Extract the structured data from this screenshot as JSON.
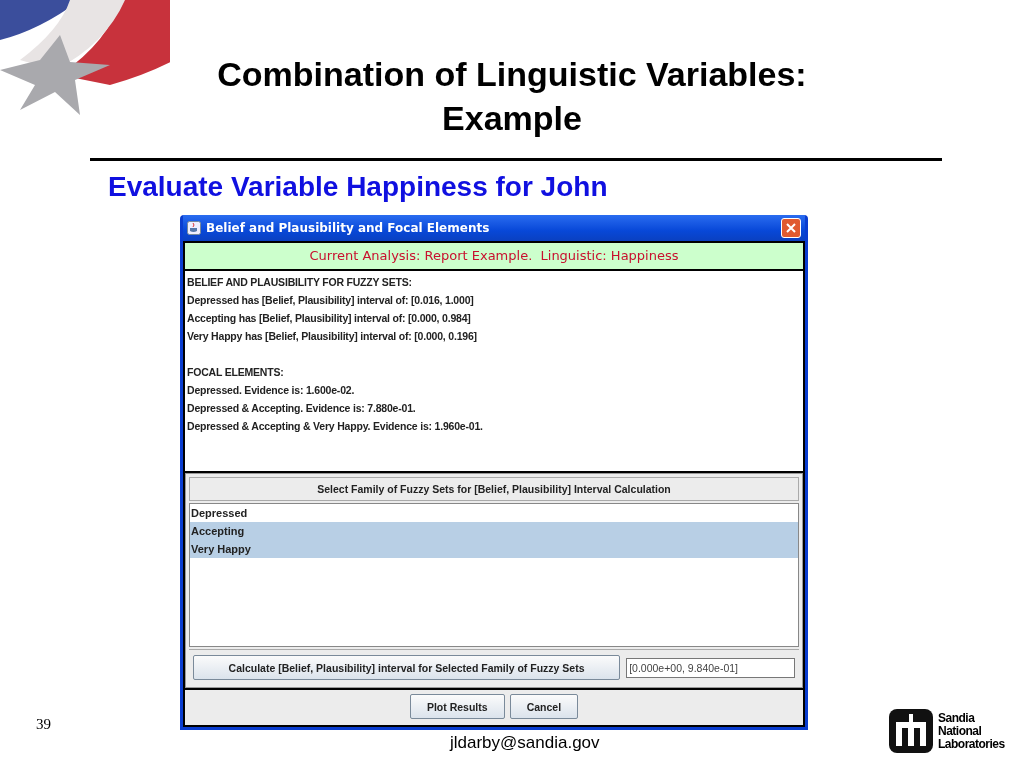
{
  "slide": {
    "title_lines": [
      "Combination of Linguistic Variables:",
      "Example"
    ],
    "subtitle": "Evaluate Variable Happiness for John",
    "page_number": "39",
    "footer": "jldarby@sandia.gov",
    "logo_lines": [
      "Sandia",
      "National",
      "Laboratories"
    ]
  },
  "window": {
    "title": "Belief and Plausibility and Focal Elements",
    "banner": "Current Analysis: Report Example.  Linguistic: Happiness",
    "report": [
      {
        "heading": "BELIEF AND PLAUSIBILITY FOR FUZZY SETS:",
        "lines": [
          "Depressed has [Belief, Plausibility] interval of: [0.016, 1.000]",
          "Accepting has [Belief, Plausibility] interval of: [0.000, 0.984]",
          "Very Happy has [Belief, Plausibility] interval of: [0.000, 0.196]"
        ]
      },
      {
        "heading": "FOCAL ELEMENTS:",
        "lines": [
          "Depressed.  Evidence is: 1.600e-02.",
          "Depressed & Accepting.  Evidence is: 7.880e-01.",
          "Depressed & Accepting & Very Happy.  Evidence is: 1.960e-01."
        ]
      }
    ],
    "selector": {
      "header": "Select Family of Fuzzy Sets for [Belief, Plausibility] Interval Calculation",
      "items": [
        {
          "label": "Depressed",
          "selected": false
        },
        {
          "label": "Accepting",
          "selected": true
        },
        {
          "label": "Very Happy",
          "selected": true
        }
      ],
      "calculate_button": "Calculate [Belief, Plausibility] interval for Selected Family of Fuzzy Sets",
      "result": "[0.000e+00, 9.840e-01]"
    },
    "buttons": [
      "Plot Results",
      "Cancel"
    ]
  }
}
